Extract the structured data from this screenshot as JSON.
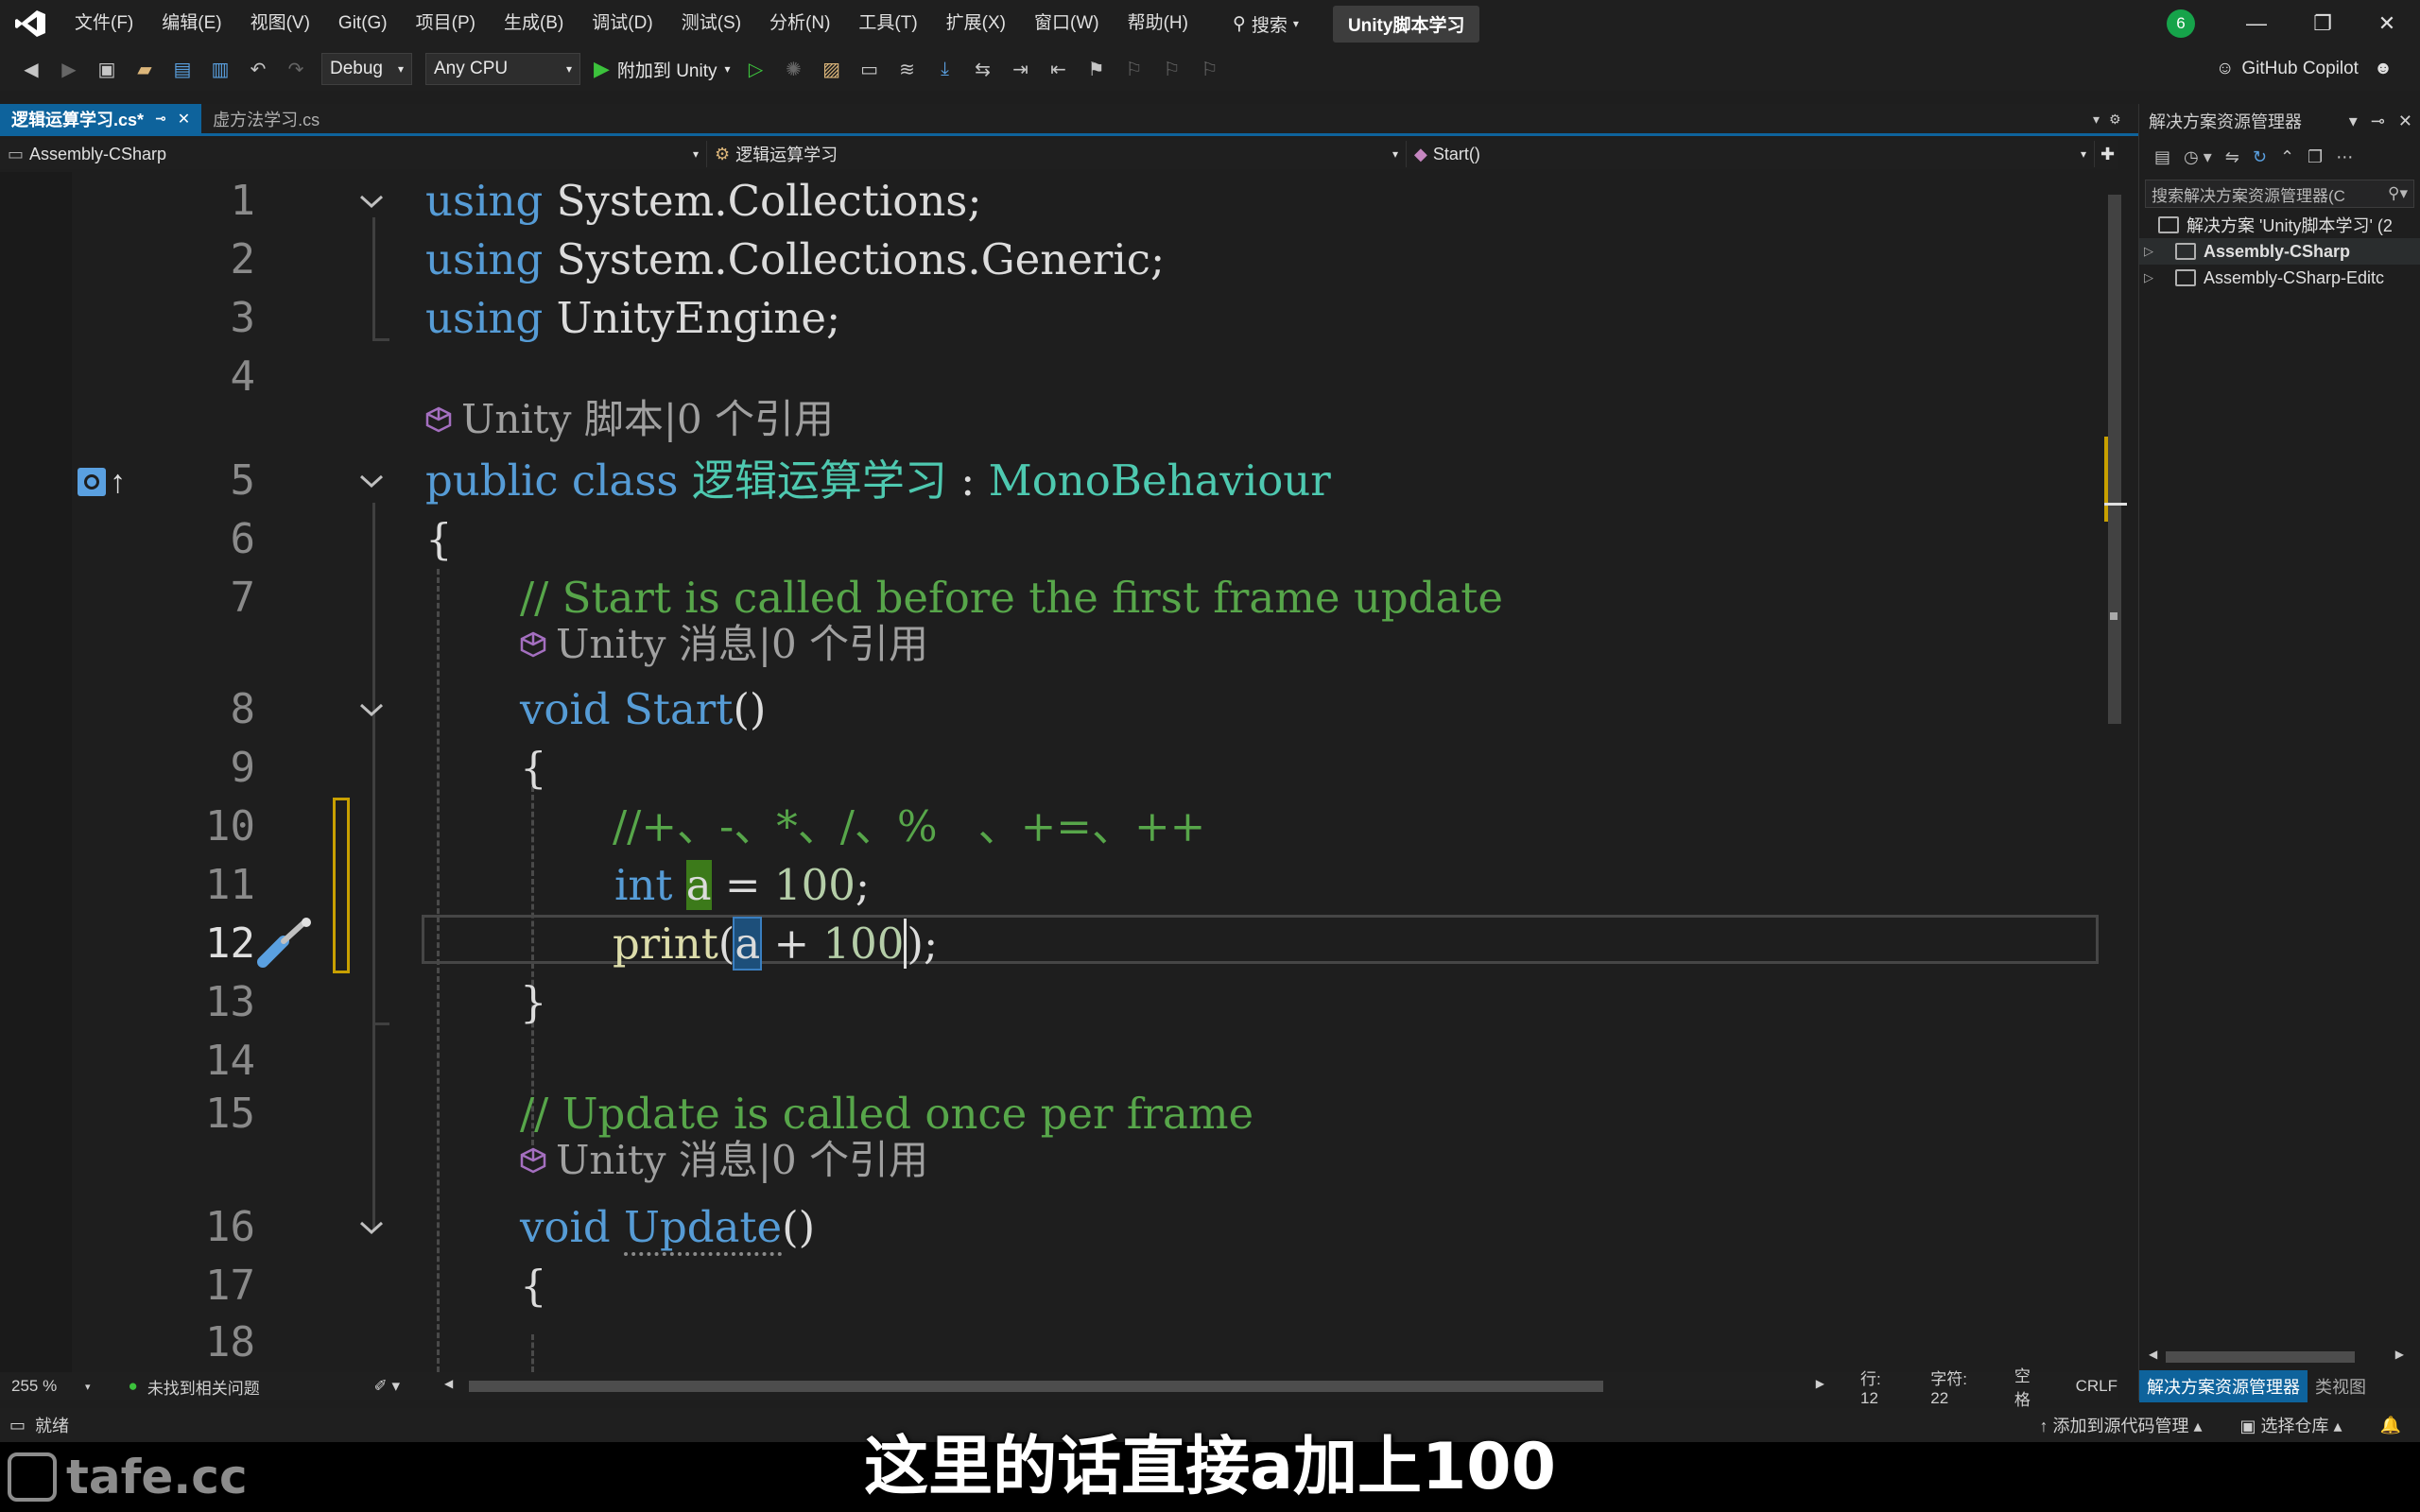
{
  "menubar": {
    "items": [
      "文件(F)",
      "编辑(E)",
      "视图(V)",
      "Git(G)",
      "项目(P)",
      "生成(B)",
      "调试(D)",
      "测试(S)",
      "分析(N)",
      "工具(T)",
      "扩展(X)",
      "窗口(W)",
      "帮助(H)"
    ],
    "search_label": "搜索",
    "solution_name": "Unity脚本学习",
    "notification_count": "6"
  },
  "toolbar": {
    "config": "Debug",
    "platform": "Any CPU",
    "attach_label": "附加到 Unity",
    "copilot_label": "GitHub Copilot"
  },
  "tabs": {
    "active": "逻辑运算学习.cs*",
    "inactive": "虚方法学习.cs"
  },
  "navbar": {
    "project": "Assembly-CSharp",
    "type": "逻辑运算学习",
    "member": "Start()"
  },
  "code": {
    "line_numbers": [
      "1",
      "2",
      "3",
      "4",
      "5",
      "6",
      "7",
      "8",
      "9",
      "10",
      "11",
      "12",
      "13",
      "14",
      "15",
      "16",
      "17",
      "18"
    ],
    "l1_kw": "using",
    "l1_rest": "System.Collections;",
    "l2_kw": "using",
    "l2_rest": "System.Collections.Generic;",
    "l3_kw": "using",
    "l3_rest": "UnityEngine;",
    "lens_class": "Unity 脚本|0 个引用",
    "l5_kw1": "public",
    "l5_kw2": "class",
    "l5_name": "逻辑运算学习",
    "l5_colon": " : ",
    "l5_base": "MonoBehaviour",
    "l6": "{",
    "l7": "// Start is called before the first frame update",
    "lens_start": "Unity 消息|0 个引用",
    "l8_kw": "void",
    "l8_name": "Start",
    "l8_paren": "()",
    "l9": "{",
    "l10": "//+、-、*、/、%   、+=、++",
    "l11_kw": "int",
    "l11_var": "a",
    "l11_eq": " = ",
    "l11_num": "100",
    "l11_semi": ";",
    "l12_fn": "print",
    "l12_open": "(",
    "l12_var": "a",
    "l12_op": " + ",
    "l12_num": "100",
    "l12_close": ")",
    "l12_semi": ";",
    "l13": "}",
    "l15": "// Update is called once per frame",
    "lens_update": "Unity 消息|0 个引用",
    "l16_kw": "void",
    "l16_name": "Update",
    "l16_paren": "()",
    "l17": "{"
  },
  "edit_status": {
    "zoom": "255 %",
    "issues": "未找到相关问题",
    "line": "行: 12",
    "col": "字符: 22",
    "spacing": "空格",
    "eol": "CRLF"
  },
  "solution_explorer": {
    "title": "解决方案资源管理器",
    "search_placeholder": "搜索解决方案资源管理器(C",
    "solution_row": "解决方案 'Unity脚本学习' (2",
    "project1": "Assembly-CSharp",
    "project2": "Assembly-CSharp-Editc",
    "bottom_tab1": "解决方案资源管理器",
    "bottom_tab2": "类视图"
  },
  "statusbar": {
    "ready": "就绪",
    "source_control": "添加到源代码管理",
    "repo": "选择仓库"
  },
  "overlay": {
    "subtitle": "这里的话直接a加上100",
    "watermark": "tafe.cc"
  },
  "colors": {
    "accent": "#0e639c",
    "keyword": "#569cd6",
    "type": "#4ec9b0",
    "comment": "#57a64a",
    "change_marker": "#c8a000"
  }
}
